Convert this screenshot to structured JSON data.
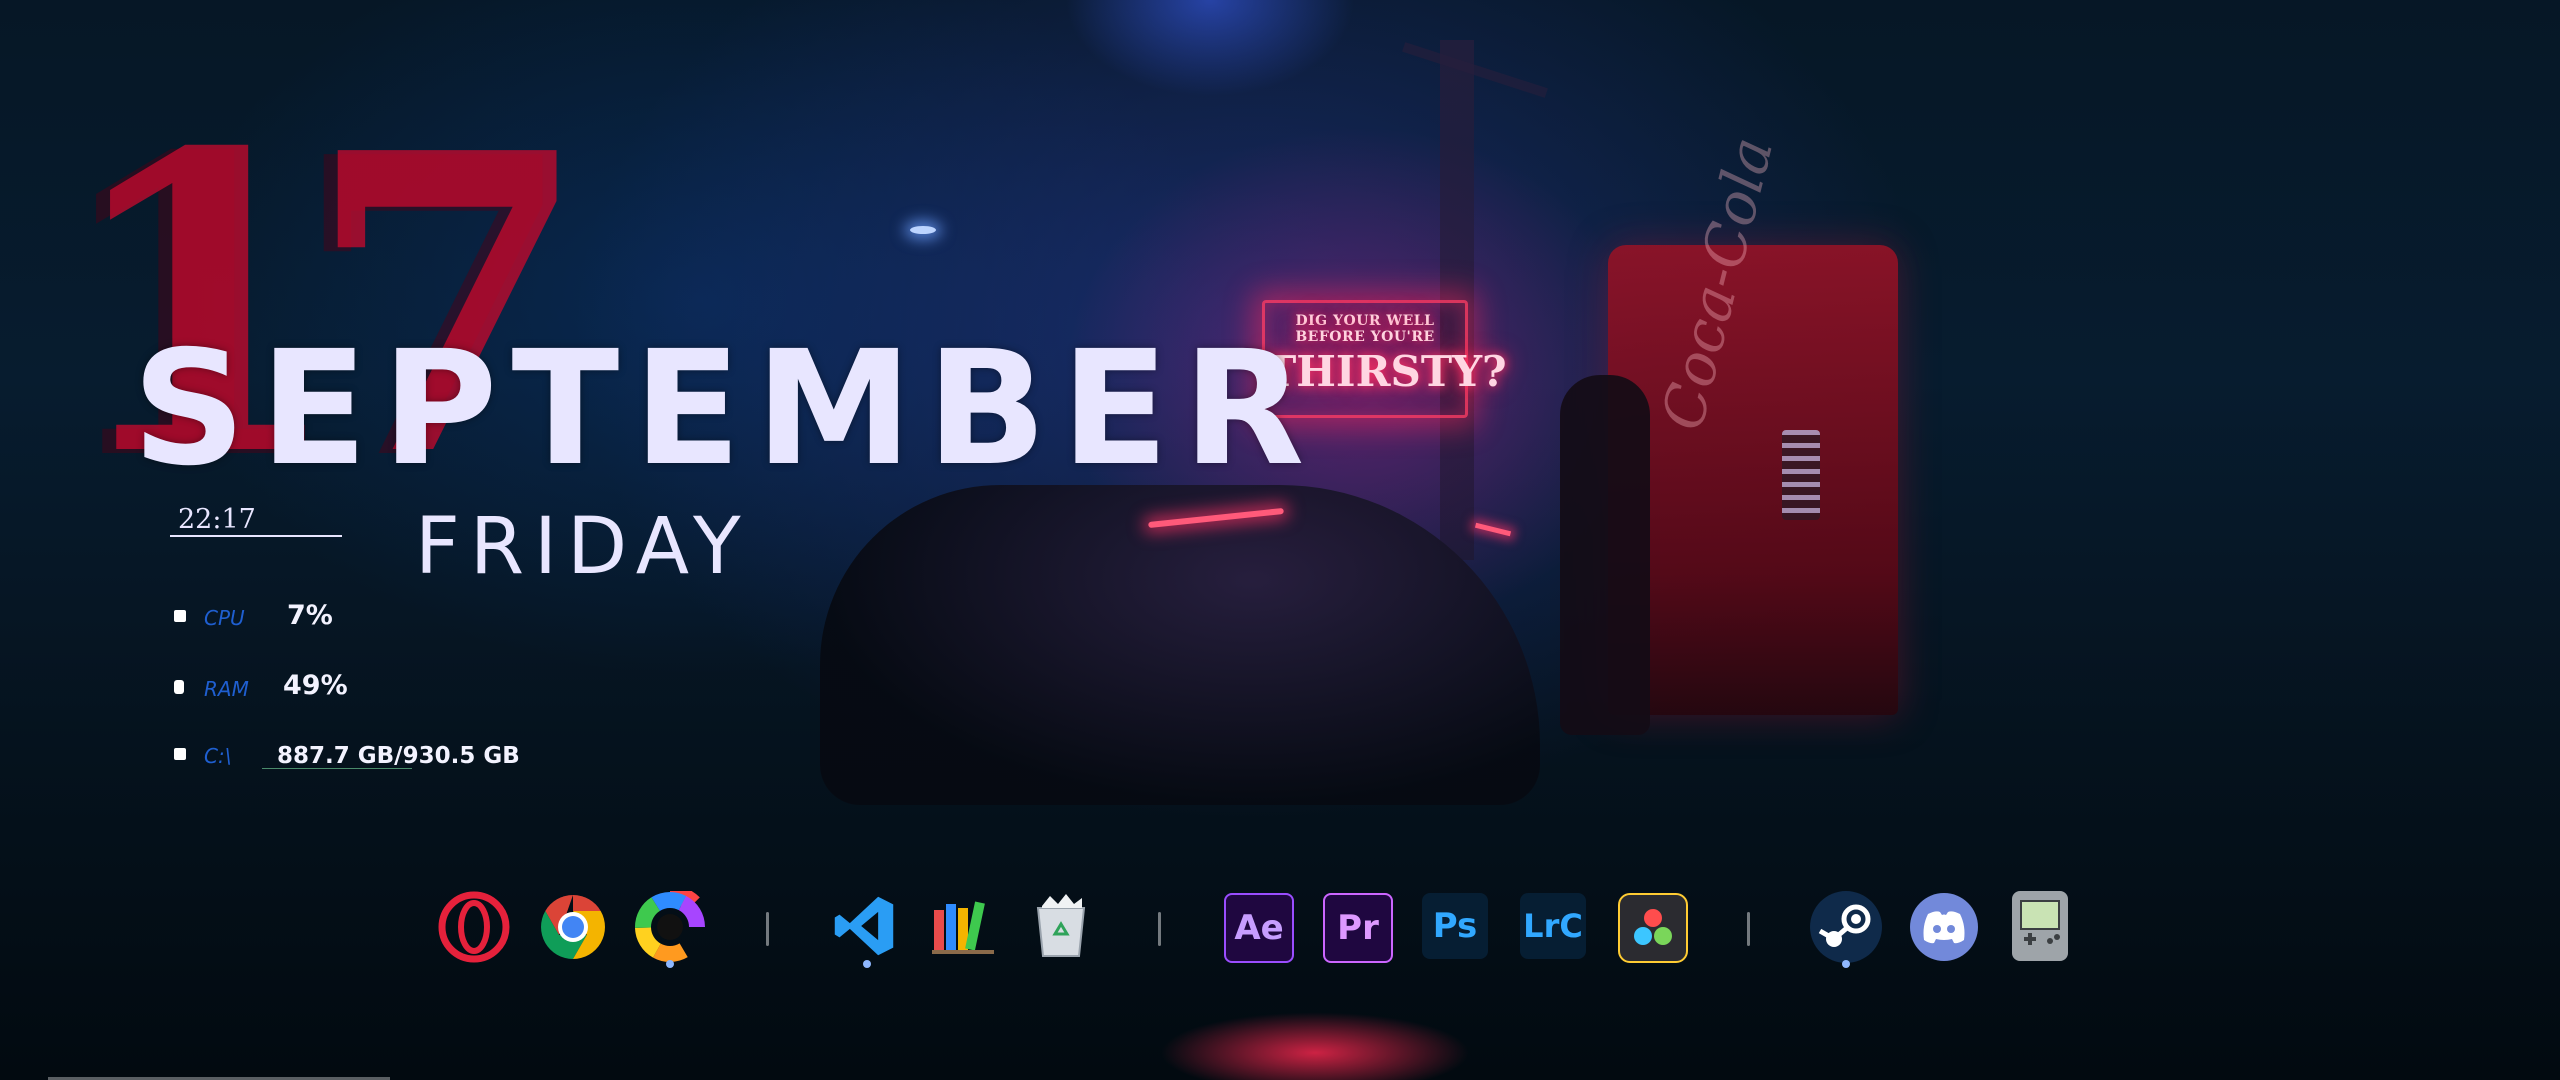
{
  "wallpaper": {
    "neon_sign_small": "DIG YOUR WELL BEFORE YOU'RE",
    "neon_sign_big": "THIRSTY?",
    "vending_brand": "Coca-Cola"
  },
  "widget": {
    "day": "17",
    "month": "SEPTEMBER",
    "weekday": "FRIDAY",
    "time": "22:17"
  },
  "stats": {
    "cpu": {
      "label": "CPU",
      "value": "7%"
    },
    "ram": {
      "label": "RAM",
      "value": "49%"
    },
    "disk": {
      "label": "C:\\",
      "value": "887.7 GB/930.5 GB"
    }
  },
  "dock": {
    "groups": [
      [
        "opera-icon",
        "chrome-icon",
        "color-wheel-icon"
      ],
      [
        "vscode-icon",
        "books-icon",
        "recycle-bin-icon"
      ],
      [
        "after-effects-icon",
        "premiere-icon",
        "photoshop-icon",
        "lightroom-classic-icon",
        "davinci-resolve-icon"
      ],
      [
        "steam-icon",
        "discord-icon",
        "game-console-icon"
      ]
    ],
    "labels": {
      "ae": "Ae",
      "pr": "Pr",
      "ps": "Ps",
      "lrc": "LrC"
    },
    "colors": {
      "opera": "#e5213b",
      "adobe_purple": "#9a4dff",
      "photoshop_blue": "#31a8ff",
      "discord": "#7289da"
    }
  }
}
